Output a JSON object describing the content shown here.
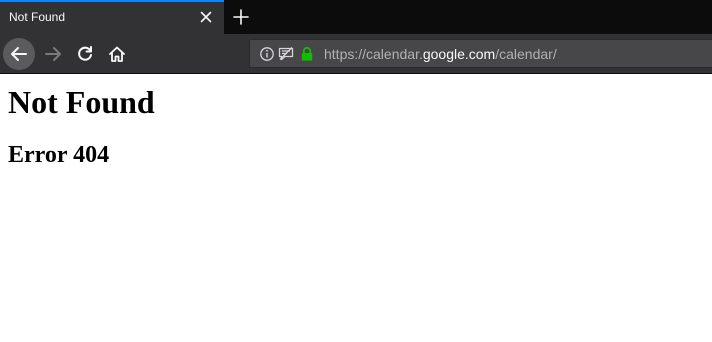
{
  "tab": {
    "title": "Not Found",
    "close_icon": "close-icon"
  },
  "toolbar": {
    "new_tab_icon": "plus-icon",
    "back_icon": "arrow-left-icon",
    "forward_icon": "arrow-right-icon",
    "reload_icon": "reload-icon",
    "home_icon": "home-icon"
  },
  "urlbar": {
    "url_prefix": "https://calendar.",
    "url_host": "google.com",
    "url_suffix": "/calendar/",
    "info_icon": "info-icon",
    "permissions_icon": "permissions-icon",
    "lock_icon": "lock-icon"
  },
  "page": {
    "heading": "Not Found",
    "subheading": "Error 404"
  },
  "colors": {
    "tab_accent": "#0a84ff",
    "chrome_bg": "#323234",
    "tabstrip_bg": "#0c0c0d",
    "lock_green": "#12bc00"
  }
}
